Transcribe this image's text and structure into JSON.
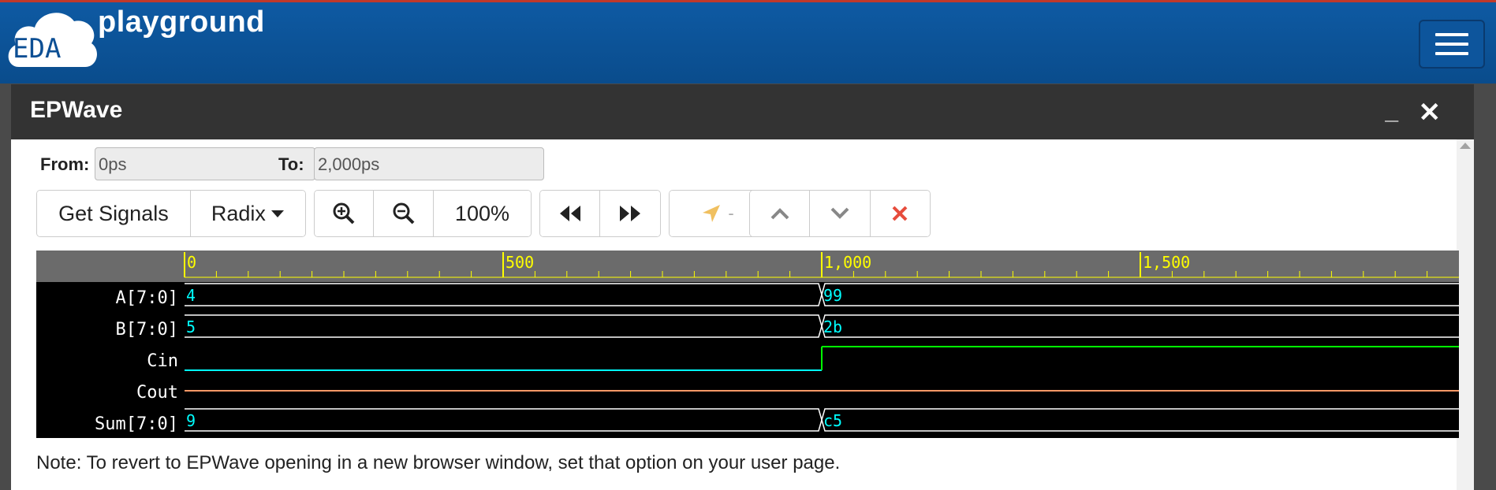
{
  "header": {
    "logo_text": "EDA",
    "brand": "playground",
    "menu_icon": "hamburger-menu-icon"
  },
  "dialog": {
    "title": "EPWave",
    "minimize_label": "_",
    "close_label": "✕"
  },
  "range": {
    "from_label": "From:",
    "from_value": "0ps",
    "to_label": "To:",
    "to_value": "2,000ps"
  },
  "toolbar": {
    "get_signals": "Get Signals",
    "radix": "Radix",
    "zoom_in_icon": "zoom-in-icon",
    "zoom_out_icon": "zoom-out-icon",
    "zoom_level": "100%",
    "prev_edge_icon": "rewind-icon",
    "next_edge_icon": "fast-forward-icon",
    "cursor_icon": "location-arrow-icon",
    "cursor_value": "-",
    "move_up_icon": "chevron-up-icon",
    "move_down_icon": "chevron-down-icon",
    "delete_icon": "delete-x-icon",
    "accent_delete": "#e74c3c",
    "accent_cursor": "#f0c060"
  },
  "timeline": {
    "ticks": [
      "0",
      "500",
      "1,000",
      "1,500"
    ],
    "tick_color": "#ffff00"
  },
  "signals": [
    {
      "name": "A[7:0]",
      "type": "bus",
      "values": [
        "4",
        "99"
      ]
    },
    {
      "name": "B[7:0]",
      "type": "bus",
      "values": [
        "5",
        "2b"
      ]
    },
    {
      "name": "Cin",
      "type": "bit",
      "values": [
        "0",
        "1"
      ]
    },
    {
      "name": "Cout",
      "type": "bit",
      "values": [
        "0"
      ]
    },
    {
      "name": "Sum[7:0]",
      "type": "bus",
      "values": [
        "9",
        "c5"
      ]
    }
  ],
  "colors": {
    "bus_value": "#00ffff",
    "cin_low": "#00ffff",
    "cin_high": "#00ff00",
    "cout": "#ff9966"
  },
  "note": "Note: To revert to EPWave opening in a new browser window, set that option on your user page."
}
